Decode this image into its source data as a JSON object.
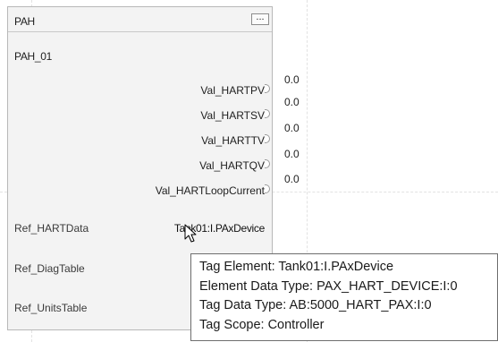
{
  "block": {
    "title": "PAH",
    "ellipsis_label": "...",
    "instance_name": "PAH_01",
    "outputs": [
      {
        "label": "Val_HARTPV",
        "value": "0.0"
      },
      {
        "label": "Val_HARTSV",
        "value": "0.0"
      },
      {
        "label": "Val_HARTTV",
        "value": "0.0"
      },
      {
        "label": "Val_HARTQV",
        "value": "0.0"
      },
      {
        "label": "Val_HARTLoopCurrent",
        "value": "0.0"
      }
    ],
    "inputs": [
      {
        "label": "Ref_HARTData",
        "value": "Tank01:I.PAxDevice"
      },
      {
        "label": "Ref_DiagTable",
        "value": ""
      },
      {
        "label": "Ref_UnitsTable",
        "value": ""
      }
    ]
  },
  "tooltip": {
    "lines": [
      "Tag Element: Tank01:I.PAxDevice",
      "Element Data Type: PAX_HART_DEVICE:I:0",
      "Tag Data Type: AB:5000_HART_PAX:I:0",
      "Tag Scope: Controller"
    ]
  },
  "icons": {
    "pointer": "mouse-pointer-icon"
  }
}
